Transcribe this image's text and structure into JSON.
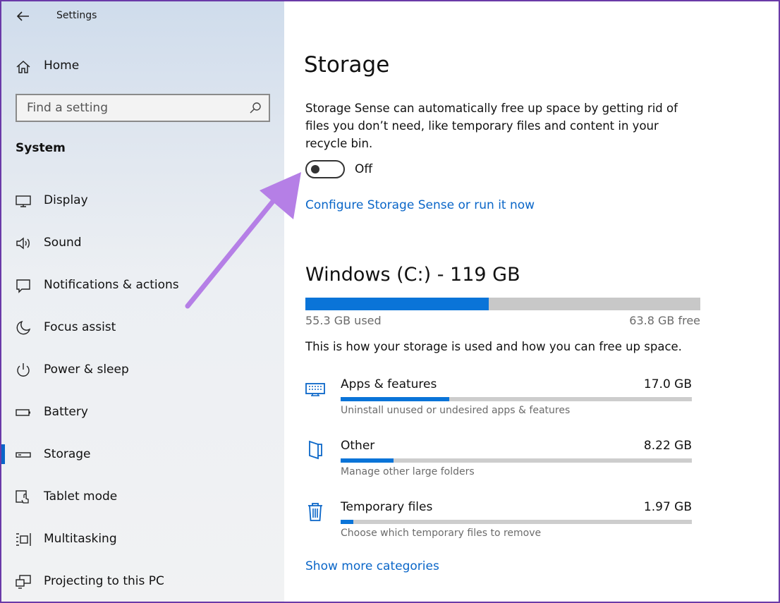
{
  "window": {
    "title": "Settings"
  },
  "sidebar": {
    "home_label": "Home",
    "search_placeholder": "Find a setting",
    "section_title": "System",
    "items": [
      {
        "label": "Display",
        "icon": "monitor-icon"
      },
      {
        "label": "Sound",
        "icon": "speaker-icon"
      },
      {
        "label": "Notifications & actions",
        "icon": "notification-icon"
      },
      {
        "label": "Focus assist",
        "icon": "moon-icon"
      },
      {
        "label": "Power & sleep",
        "icon": "power-icon"
      },
      {
        "label": "Battery",
        "icon": "battery-icon"
      },
      {
        "label": "Storage",
        "icon": "storage-icon",
        "active": true
      },
      {
        "label": "Tablet mode",
        "icon": "tablet-icon"
      },
      {
        "label": "Multitasking",
        "icon": "multitasking-icon"
      },
      {
        "label": "Projecting to this PC",
        "icon": "projecting-icon"
      }
    ]
  },
  "main": {
    "title": "Storage",
    "description": "Storage Sense can automatically free up space by getting rid of files you don’t need, like temporary files and content in your recycle bin.",
    "storage_sense": {
      "state": "Off",
      "enabled": false
    },
    "configure_link": "Configure Storage Sense or run it now",
    "drive": {
      "title": "Windows (C:) - 119 GB",
      "used_label": "55.3 GB used",
      "free_label": "63.8 GB free",
      "used_fraction": 0.465
    },
    "how_text": "This is how your storage is used and how you can free up space.",
    "categories": [
      {
        "name": "Apps & features",
        "size": "17.0 GB",
        "subtitle": "Uninstall unused or undesired apps & features",
        "fraction": 0.31,
        "icon": "apps-icon"
      },
      {
        "name": "Other",
        "size": "8.22 GB",
        "subtitle": "Manage other large folders",
        "fraction": 0.15,
        "icon": "folder-icon"
      },
      {
        "name": "Temporary files",
        "size": "1.97 GB",
        "subtitle": "Choose which temporary files to remove",
        "fraction": 0.036,
        "icon": "trash-icon"
      }
    ],
    "more_link": "Show more categories"
  },
  "colors": {
    "accent": "#0a66c8",
    "bar_fill": "#0a74d8",
    "annotation_arrow": "#b57fe6"
  }
}
